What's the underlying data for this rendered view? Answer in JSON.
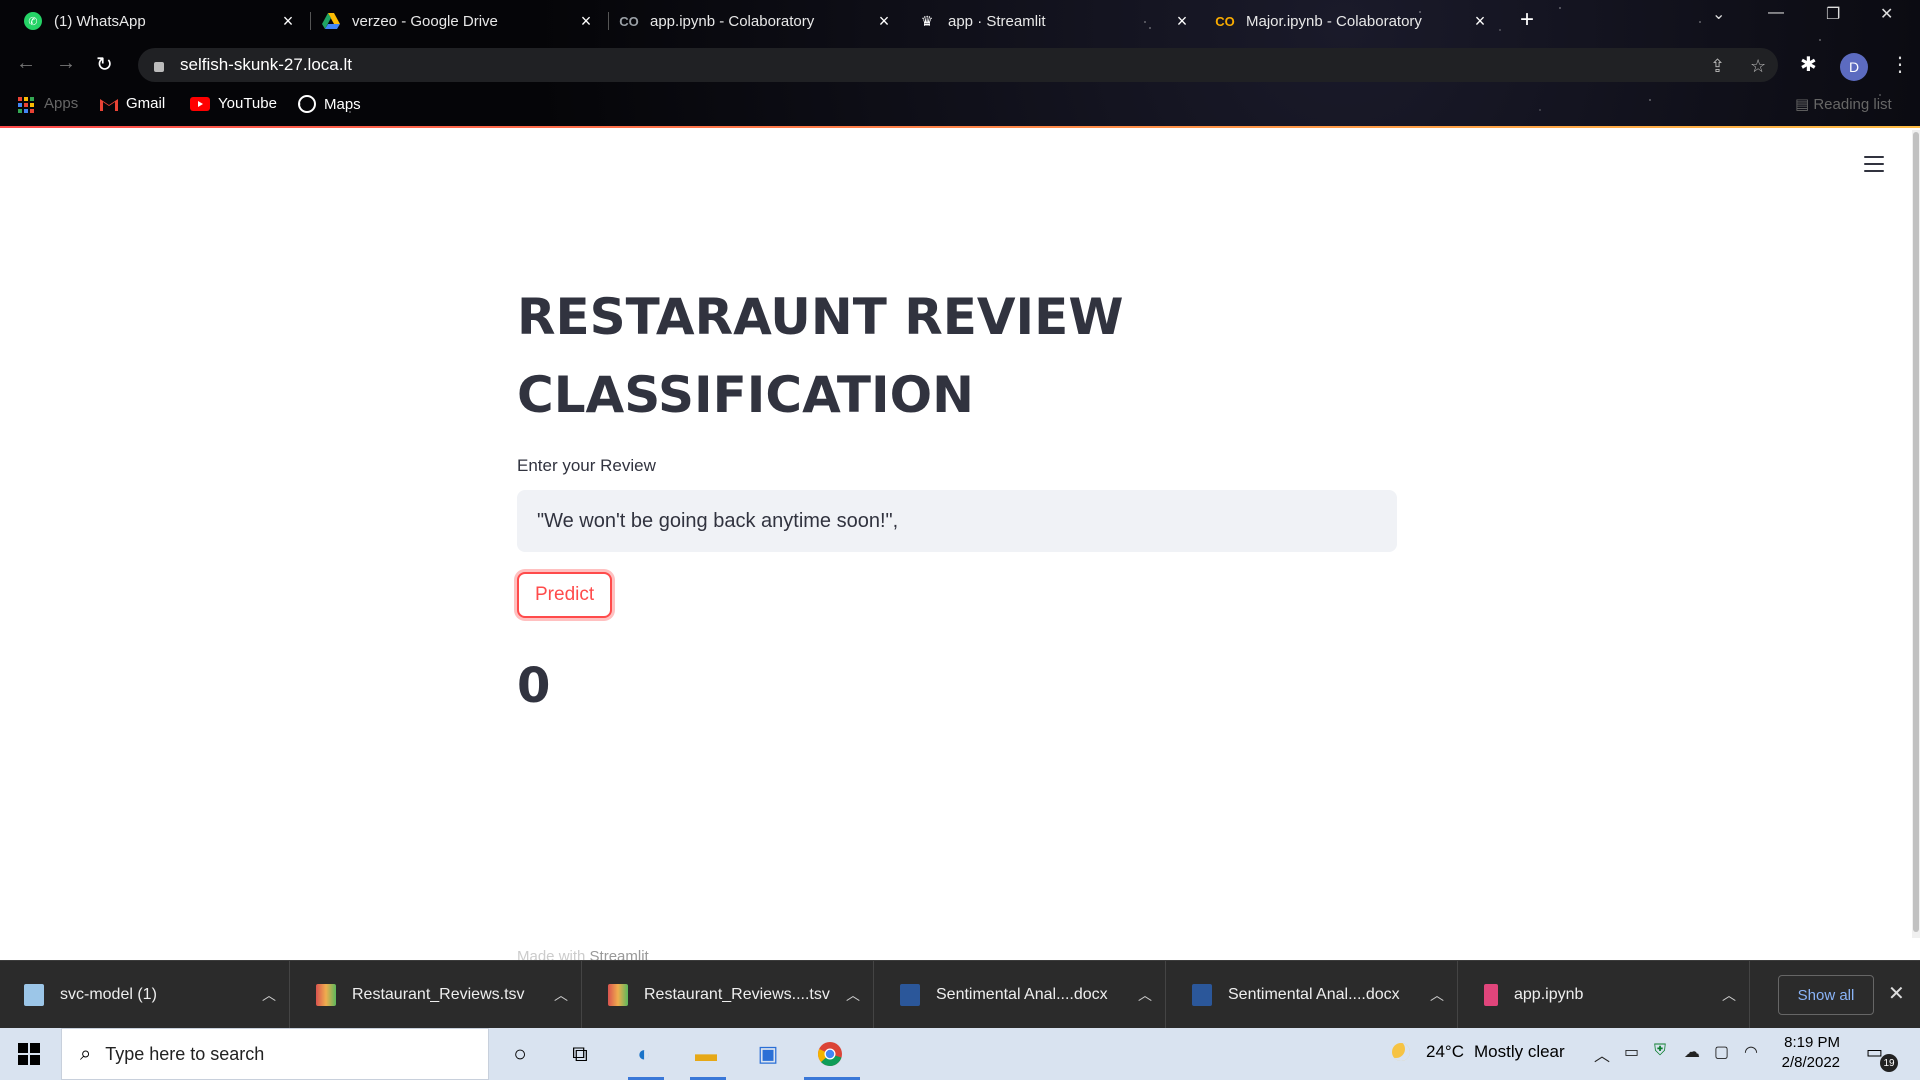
{
  "browser": {
    "tabs": [
      {
        "title": "(1) WhatsApp",
        "icon": "whatsapp-icon",
        "color": "#25d366"
      },
      {
        "title": "verzeo - Google Drive",
        "icon": "google-drive-icon",
        "color": "#1fa463"
      },
      {
        "title": "app.ipynb - Colaboratory",
        "icon": "colab-icon",
        "color": "#9aa0a6"
      },
      {
        "title": "app · Streamlit",
        "icon": "streamlit-icon",
        "color": "#ffffff"
      },
      {
        "title": "Major.ipynb - Colaboratory",
        "icon": "colab-icon",
        "color": "#f9ab00"
      }
    ],
    "url": "selfish-skunk-27.loca.lt",
    "avatar_letter": "D",
    "bookmarks": [
      {
        "label": "Apps",
        "icon": "apps-grid-icon"
      },
      {
        "label": "Gmail",
        "icon": "gmail-icon"
      },
      {
        "label": "YouTube",
        "icon": "youtube-icon"
      },
      {
        "label": "Maps",
        "icon": "maps-icon"
      }
    ],
    "reading_list": "Reading list"
  },
  "app": {
    "title": "RESTARAUNT REVIEW CLASSIFICATION",
    "input_label": "Enter your Review",
    "input_value": "\"We won't be going back anytime soon!\",",
    "button_label": "Predict",
    "result": "0",
    "footer_prefix": "Made with",
    "footer_brand": "Streamlit",
    "accent_color": "#ff4b4b"
  },
  "downloads": {
    "items": [
      {
        "name": "svc-model (1)",
        "icon": "file-icon",
        "color": "#9cc6e8"
      },
      {
        "name": "Restaurant_Reviews.tsv",
        "icon": "spreadsheet-icon",
        "color": "#d9534f"
      },
      {
        "name": "Restaurant_Reviews....tsv",
        "icon": "spreadsheet-icon",
        "color": "#d9534f"
      },
      {
        "name": "Sentimental Anal....docx",
        "icon": "word-doc-icon",
        "color": "#2b579a"
      },
      {
        "name": "Sentimental Anal....docx",
        "icon": "word-doc-icon",
        "color": "#2b579a"
      },
      {
        "name": "app.ipynb",
        "icon": "notebook-icon",
        "color": "#e0457b"
      }
    ],
    "show_all": "Show all"
  },
  "taskbar": {
    "search_placeholder": "Type here to search",
    "weather_temp": "24°C",
    "weather_text": "Mostly clear",
    "time": "8:19 PM",
    "date": "2/8/2022",
    "notification_count": "19"
  }
}
